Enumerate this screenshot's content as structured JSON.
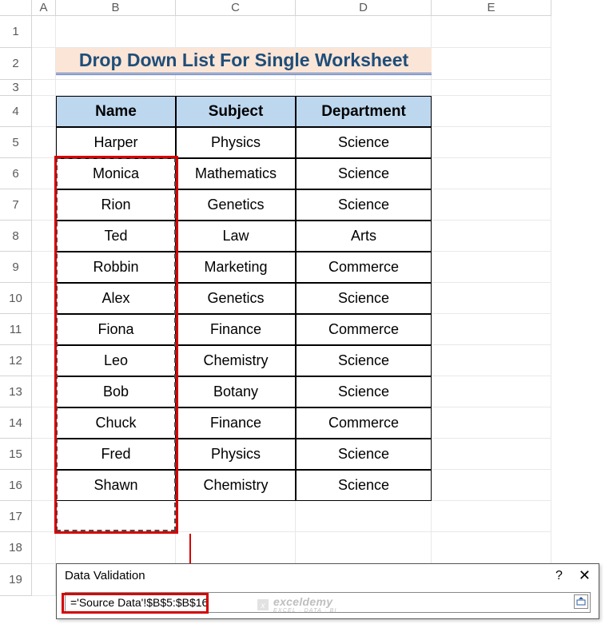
{
  "columns": [
    "A",
    "B",
    "C",
    "D",
    "E"
  ],
  "rows": [
    "1",
    "2",
    "3",
    "4",
    "5",
    "6",
    "7",
    "8",
    "9",
    "10",
    "11",
    "12",
    "13",
    "14",
    "15",
    "16",
    "17",
    "18",
    "19"
  ],
  "title": "Drop Down List For Single Worksheet",
  "headers": {
    "name": "Name",
    "subject": "Subject",
    "dept": "Department"
  },
  "table": [
    {
      "name": "Harper",
      "subject": "Physics",
      "dept": "Science"
    },
    {
      "name": "Monica",
      "subject": "Mathematics",
      "dept": "Science"
    },
    {
      "name": "Rion",
      "subject": "Genetics",
      "dept": "Science"
    },
    {
      "name": "Ted",
      "subject": "Law",
      "dept": "Arts"
    },
    {
      "name": "Robbin",
      "subject": "Marketing",
      "dept": "Commerce"
    },
    {
      "name": "Alex",
      "subject": "Genetics",
      "dept": "Science"
    },
    {
      "name": "Fiona",
      "subject": "Finance",
      "dept": "Commerce"
    },
    {
      "name": "Leo",
      "subject": "Chemistry",
      "dept": "Science"
    },
    {
      "name": "Bob",
      "subject": "Botany",
      "dept": "Science"
    },
    {
      "name": "Chuck",
      "subject": "Finance",
      "dept": "Commerce"
    },
    {
      "name": "Fred",
      "subject": "Physics",
      "dept": "Science"
    },
    {
      "name": "Shawn",
      "subject": "Chemistry",
      "dept": "Science"
    }
  ],
  "dv": {
    "title": "Data Validation",
    "help": "?",
    "close": "✕",
    "formula": "='Source Data'!$B$5:$B$16"
  },
  "watermark": {
    "main": "exceldemy",
    "sub": "EXCEL · DATA · BI"
  },
  "chart_data": {
    "type": "table",
    "title": "Drop Down List For Single Worksheet",
    "columns": [
      "Name",
      "Subject",
      "Department"
    ],
    "rows": [
      [
        "Harper",
        "Physics",
        "Science"
      ],
      [
        "Monica",
        "Mathematics",
        "Science"
      ],
      [
        "Rion",
        "Genetics",
        "Science"
      ],
      [
        "Ted",
        "Law",
        "Arts"
      ],
      [
        "Robbin",
        "Marketing",
        "Commerce"
      ],
      [
        "Alex",
        "Genetics",
        "Science"
      ],
      [
        "Fiona",
        "Finance",
        "Commerce"
      ],
      [
        "Leo",
        "Chemistry",
        "Science"
      ],
      [
        "Bob",
        "Botany",
        "Science"
      ],
      [
        "Chuck",
        "Finance",
        "Commerce"
      ],
      [
        "Fred",
        "Physics",
        "Science"
      ],
      [
        "Shawn",
        "Chemistry",
        "Science"
      ]
    ]
  }
}
